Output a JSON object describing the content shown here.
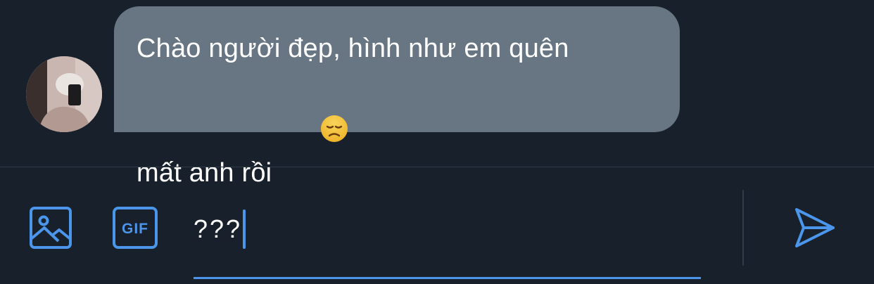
{
  "conversation": {
    "messages": [
      {
        "line1": "Chào người đẹp, hình như em quên",
        "line2": "mất anh rồi",
        "emoji": "disappointed-face-emoji"
      }
    ]
  },
  "composer": {
    "input_value": "???",
    "media_icon": "image-icon",
    "gif_label": "GIF",
    "send_icon": "send-icon",
    "accent_color": "#4b96ea"
  },
  "theme": {
    "background": "#17202b",
    "bubble_color": "#687684",
    "divider_color": "#2f3b47"
  }
}
